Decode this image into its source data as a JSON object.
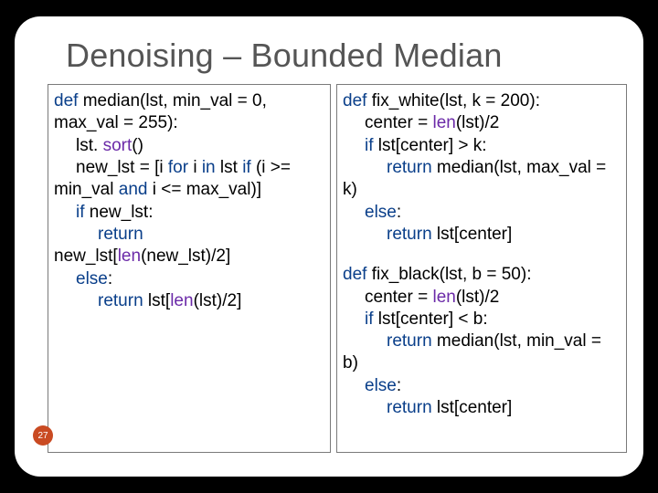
{
  "title": "Denoising – Bounded Median",
  "page_number": "27",
  "kw": {
    "def": "def",
    "for": "for",
    "in": "in",
    "if": "if",
    "and": "and",
    "else": "else",
    "return": "return"
  },
  "builtin": {
    "sort": "sort",
    "len": "len"
  },
  "left": {
    "l1a": " median(lst, min_val = 0, max_val = 255):",
    "l2a": "lst. ",
    "l2b": "()",
    "l3a": "new_lst = [i ",
    "l3b": " i ",
    "l3c": " lst ",
    "l3d": " (i >= min_val ",
    "l3e": " i <= max_val)]",
    "l4a": " new_lst:",
    "l5a": " new_lst[",
    "l5b": "(new_lst)/2]",
    "l6a": ":",
    "l7a": " lst[",
    "l7b": "(lst)/2]"
  },
  "right": {
    "l1a": " fix_white(lst, k = 200):",
    "l2a": "center = ",
    "l2b": "(lst)/2",
    "l3a": " lst[center] > k:",
    "l4a": " median(lst, max_val = k)",
    "l5a": ":",
    "l6a": " lst[center]",
    "l8a": " fix_black(lst, b = 50):",
    "l9a": "center = ",
    "l9b": "(lst)/2",
    "l10a": " lst[center] < b:",
    "l11a": " median(lst, min_val = b)",
    "l12a": ":",
    "l13a": " lst[center]"
  }
}
